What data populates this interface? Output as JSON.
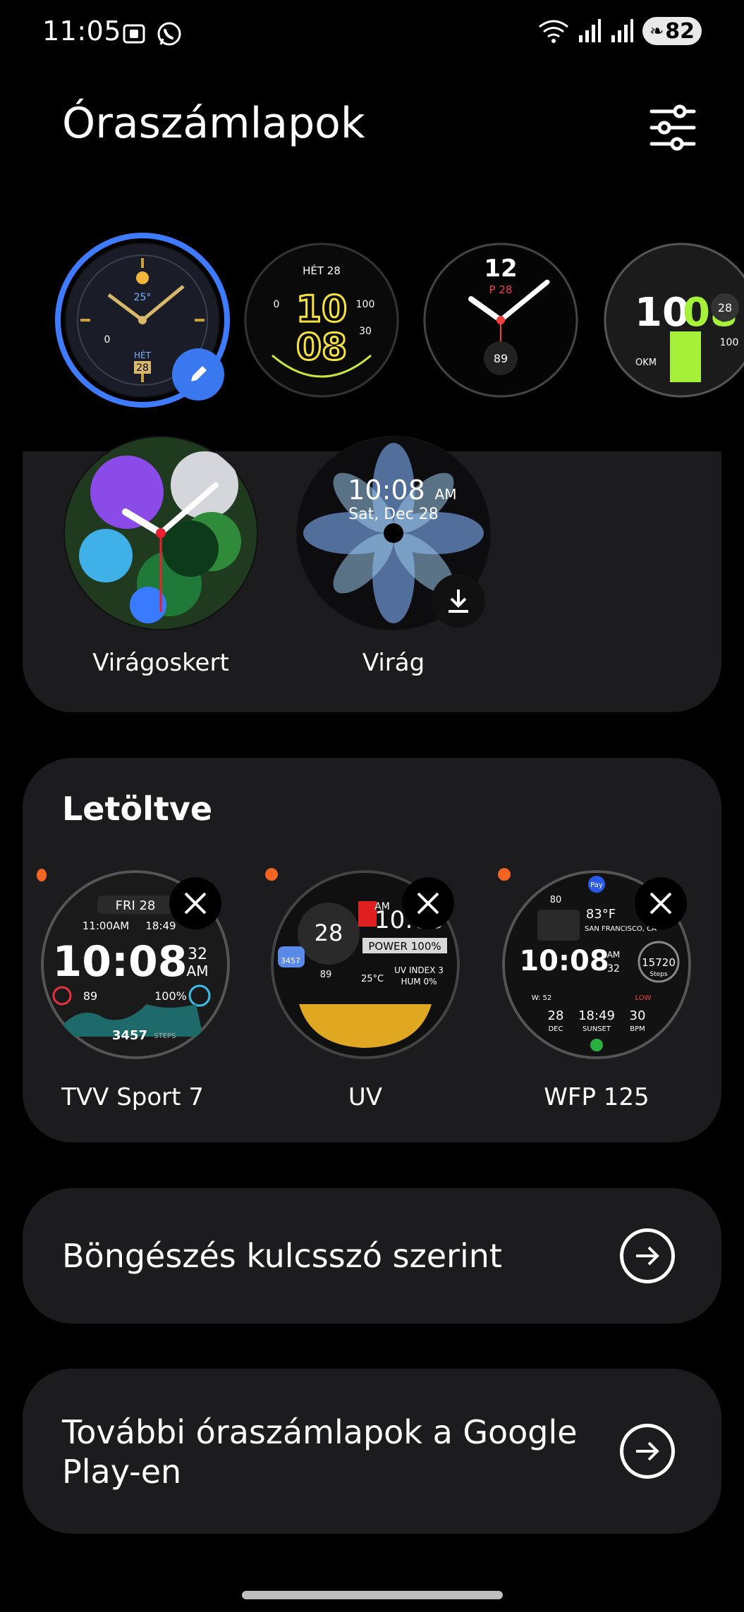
{
  "status_bar": {
    "time": "11:05",
    "battery": "82",
    "icons": [
      "screenshot-icon",
      "whatsapp-icon",
      "wifi-icon",
      "signal-icon",
      "signal-icon"
    ]
  },
  "header": {
    "title": "Óraszámlapok",
    "filter_icon": "sliders-icon"
  },
  "watch_strip": [
    {
      "name": "watch-face-1",
      "selected": true,
      "text": [
        "25°",
        "HÉT",
        "28",
        "0"
      ]
    },
    {
      "name": "watch-face-2",
      "text": [
        "HÉT 28",
        "10",
        "08",
        "100",
        "30",
        "0"
      ]
    },
    {
      "name": "watch-face-3",
      "text": [
        "12",
        "P 28",
        "89"
      ]
    },
    {
      "name": "watch-face-4",
      "text": [
        "10",
        "08",
        "28",
        "OKM",
        "100"
      ]
    }
  ],
  "recommended": {
    "items": [
      {
        "label": "Virágoskert"
      },
      {
        "label": "Virág",
        "face_time": "10:08",
        "face_ampm": "AM",
        "face_date": "Sat, Dec 28"
      }
    ]
  },
  "downloaded": {
    "title": "Letöltve",
    "items": [
      {
        "label": "TVV Sport 7",
        "face": {
          "date": "FRI 28",
          "alarm": "11:00AM",
          "sub": "18:49",
          "time": "10:08",
          "sec": "32",
          "ampm": "AM",
          "hr": "89",
          "pct": "100%",
          "steps": "3457",
          "steps_label": "STEPS"
        }
      },
      {
        "label": "UV",
        "face": {
          "day": "28",
          "time": "10:08",
          "ampm": "AM",
          "power": "POWER 100%",
          "uv": "UV INDEX 3",
          "hum": "HUM 0%",
          "temp": "25°C",
          "hr": "89",
          "steps": "3457"
        }
      },
      {
        "label": "WFP 125",
        "face": {
          "pay": "Pay",
          "bat": "80",
          "temp": "83°F",
          "city": "SAN FRANCISCO, CA",
          "time": "10:08",
          "ampm": "AM",
          "sec": "32",
          "steps": "15720",
          "steps_label": "Steps",
          "week": "W: 52",
          "low": "LOW",
          "d1": "28",
          "d1l": "DEC",
          "d2": "18:49",
          "d2l": "SUNSET",
          "d3": "30",
          "d3l": "BPM"
        }
      }
    ]
  },
  "browse": {
    "label": "Böngészés kulcsszó szerint"
  },
  "more": {
    "label_line1": "További óraszámlapok a Google",
    "label_line2": "Play-en"
  },
  "colors": {
    "accent": "#3f7bff",
    "card": "#1c1c1e",
    "dot": "#f26522",
    "bg": "#000000"
  }
}
